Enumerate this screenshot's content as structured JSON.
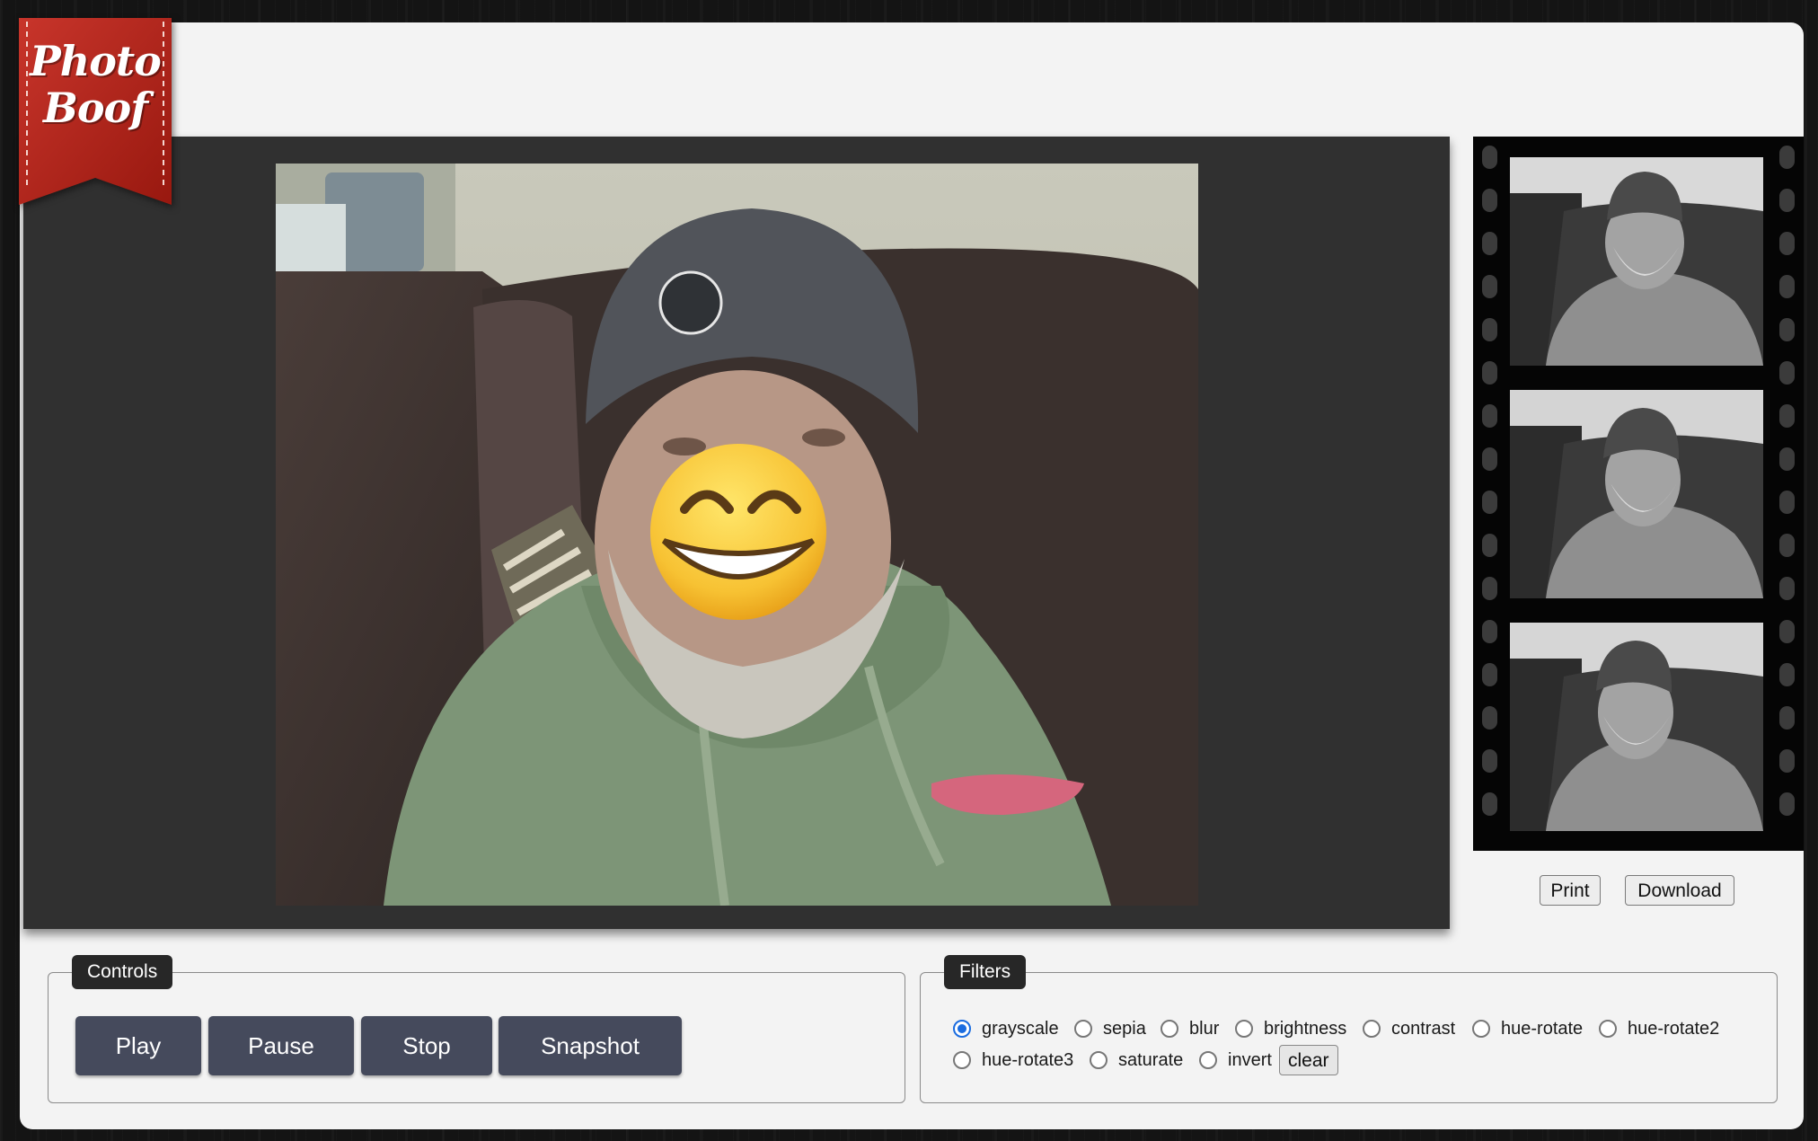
{
  "app": {
    "logo_line1": "Photo",
    "logo_line2": "Boof",
    "brand_color": "#b3241c"
  },
  "camera": {
    "icon": "smiling-face-emoji-icon",
    "overlay_icon": "😁",
    "live_filter": "none"
  },
  "photo_strip": {
    "frames": [
      {
        "filter": "grayscale"
      },
      {
        "filter": "grayscale"
      },
      {
        "filter": "grayscale"
      }
    ],
    "print_label": "Print",
    "download_label": "Download"
  },
  "controls": {
    "legend": "Controls",
    "buttons": [
      "Play",
      "Pause",
      "Stop",
      "Snapshot"
    ],
    "button_color": "#454a5c"
  },
  "filters": {
    "legend": "Filters",
    "options": [
      "grayscale",
      "sepia",
      "blur",
      "brightness",
      "contrast",
      "hue-rotate",
      "hue-rotate2",
      "hue-rotate3",
      "saturate",
      "invert"
    ],
    "selected": "grayscale",
    "clear_label": "clear",
    "accent_color": "#1a6ce0"
  }
}
